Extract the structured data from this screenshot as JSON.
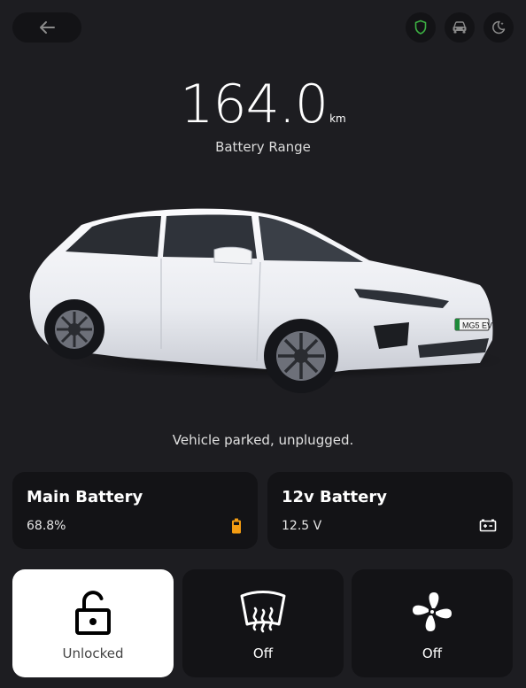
{
  "header": {
    "back_icon": "arrow-left-icon",
    "icons": [
      "shield-icon",
      "car-icon",
      "moon-icon"
    ],
    "shield_color": "#3cb043"
  },
  "range": {
    "value": "164.0",
    "unit": "km",
    "label": "Battery Range"
  },
  "vehicle": {
    "plate": "MG5 EV",
    "status": "Vehicle parked, unplugged."
  },
  "batteries": {
    "main": {
      "title": "Main Battery",
      "value": "68.8%",
      "icon": "battery-icon",
      "icon_color": "#f39c12"
    },
    "aux": {
      "title": "12v Battery",
      "value": "12.5 V",
      "icon": "car-battery-icon"
    }
  },
  "controls": [
    {
      "label": "Unlocked",
      "icon": "lock-open-icon",
      "active": true
    },
    {
      "label": "Off",
      "icon": "defrost-icon",
      "active": false
    },
    {
      "label": "Off",
      "icon": "fan-icon",
      "active": false
    }
  ]
}
